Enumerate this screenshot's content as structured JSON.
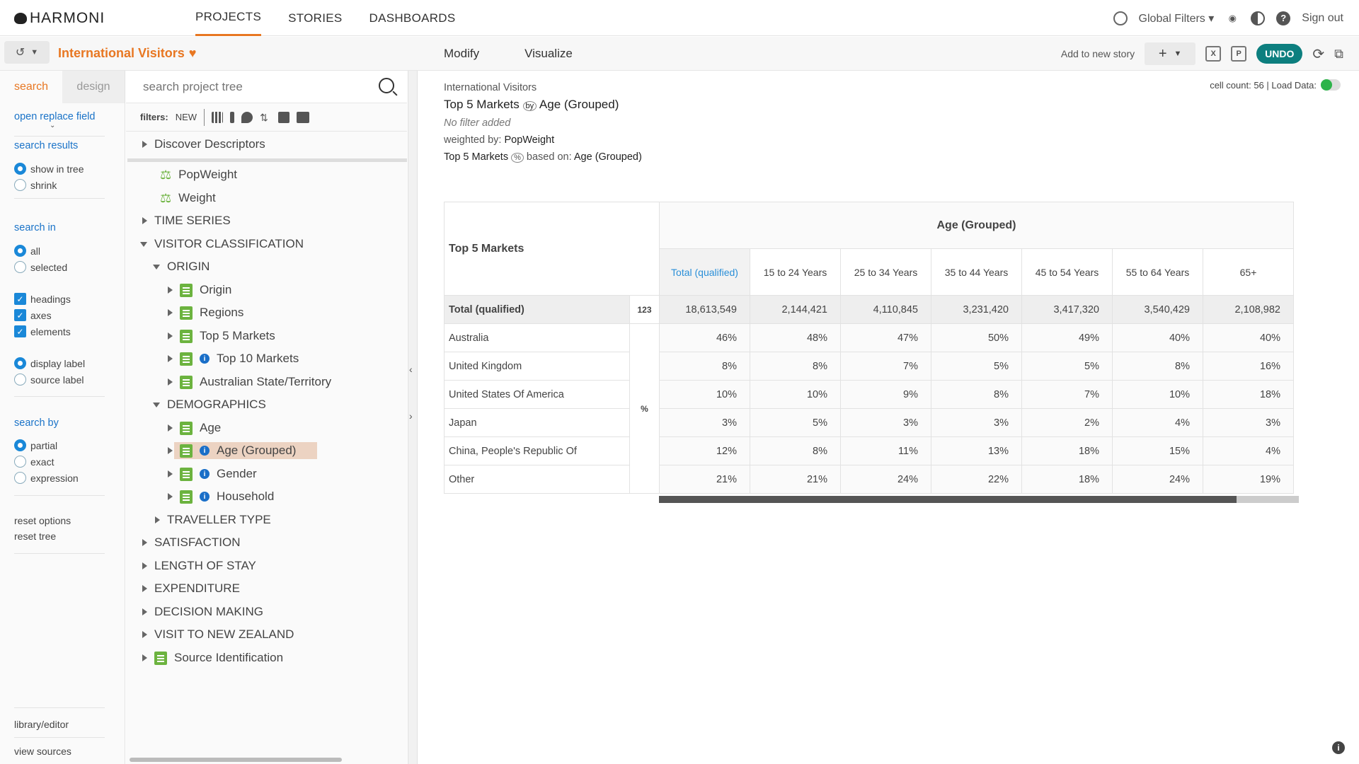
{
  "brand": "HARMONI",
  "nav": {
    "projects": "PROJECTS",
    "stories": "STORIES",
    "dashboards": "DASHBOARDS"
  },
  "topright": {
    "global_filters": "Global Filters",
    "sign_out": "Sign out"
  },
  "project": {
    "title": "International Visitors"
  },
  "modes": {
    "modify": "Modify",
    "visualize": "Visualize"
  },
  "toolbar": {
    "add_story": "Add to new story",
    "undo": "UNDO"
  },
  "left": {
    "tab_search": "search",
    "tab_design": "design",
    "open_replace": "open replace field",
    "search_results": "search results",
    "show_in_tree": "show in tree",
    "shrink": "shrink",
    "search_in": "search in",
    "all": "all",
    "selected": "selected",
    "headings": "headings",
    "axes": "axes",
    "elements": "elements",
    "display_label": "display label",
    "source_label": "source label",
    "search_by": "search by",
    "partial": "partial",
    "exact": "exact",
    "expression": "expression",
    "reset_options": "reset options",
    "reset_tree": "reset tree",
    "library": "library/editor",
    "view_sources": "view sources"
  },
  "tree": {
    "search_placeholder": "search project tree",
    "filters_label": "filters:",
    "filters_new": "NEW",
    "items": {
      "discover": "Discover Descriptors",
      "popweight": "PopWeight",
      "weight": "Weight",
      "time_series": "TIME SERIES",
      "visitor_class": "VISITOR CLASSIFICATION",
      "origin_group": "ORIGIN",
      "origin": "Origin",
      "regions": "Regions",
      "top5": "Top 5 Markets",
      "top10": "Top 10 Markets",
      "aus_state": "Australian State/Territory",
      "demographics": "DEMOGRAPHICS",
      "age": "Age",
      "age_grouped": "Age (Grouped)",
      "gender": "Gender",
      "household": "Household",
      "traveller": "TRAVELLER TYPE",
      "satisfaction": "SATISFACTION",
      "length_stay": "LENGTH OF STAY",
      "expenditure": "EXPENDITURE",
      "decision": "DECISION MAKING",
      "visit_nz": "VISIT TO NEW ZEALAND",
      "source_id": "Source Identification"
    }
  },
  "meta": {
    "project": "International Visitors",
    "row_var": "Top 5 Markets",
    "by": "by",
    "col_var": "Age (Grouped)",
    "no_filter": "No filter added",
    "weighted_by_label": "weighted by:",
    "weighted_by": "PopWeight",
    "pct_row": "Top 5 Markets",
    "pct_symbol": "%",
    "based_on_label": "based on:",
    "based_on": "Age (Grouped)",
    "cell_count": "cell count: 56 | Load Data:"
  },
  "table": {
    "corner": "Top 5 Markets",
    "group_header": "Age (Grouped)",
    "stat_count": "123",
    "stat_pct": "%",
    "columns": [
      "Total (qualified)",
      "15 to 24 Years",
      "25 to 34 Years",
      "35 to 44 Years",
      "45 to 54 Years",
      "55 to 64 Years",
      "65+"
    ],
    "total_row": {
      "label": "Total (qualified)",
      "values": [
        "18,613,549",
        "2,144,421",
        "4,110,845",
        "3,231,420",
        "3,417,320",
        "3,540,429",
        "2,108,982"
      ]
    },
    "rows": [
      {
        "label": "Australia",
        "values": [
          "46%",
          "48%",
          "47%",
          "50%",
          "49%",
          "40%",
          "40%"
        ]
      },
      {
        "label": "United Kingdom",
        "values": [
          "8%",
          "8%",
          "7%",
          "5%",
          "5%",
          "8%",
          "16%"
        ]
      },
      {
        "label": "United States Of America",
        "values": [
          "10%",
          "10%",
          "9%",
          "8%",
          "7%",
          "10%",
          "18%"
        ]
      },
      {
        "label": "Japan",
        "values": [
          "3%",
          "5%",
          "3%",
          "3%",
          "2%",
          "4%",
          "3%"
        ]
      },
      {
        "label": "China, People's Republic Of",
        "values": [
          "12%",
          "8%",
          "11%",
          "13%",
          "18%",
          "15%",
          "4%"
        ]
      },
      {
        "label": "Other",
        "values": [
          "21%",
          "21%",
          "24%",
          "22%",
          "18%",
          "24%",
          "19%"
        ]
      }
    ]
  }
}
